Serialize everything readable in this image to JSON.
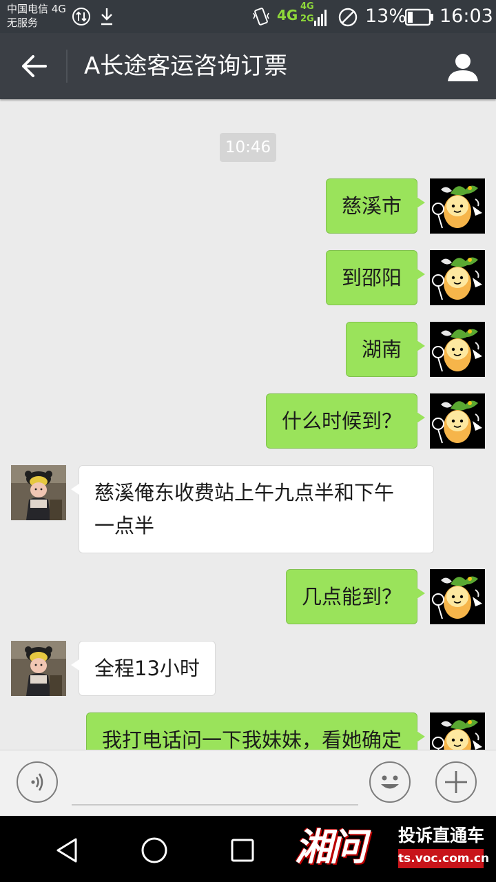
{
  "status_bar": {
    "carrier_line1": "中国电信 4G",
    "carrier_line2": "无服务",
    "network_4g": "4G",
    "network_sub_4g": "4G",
    "network_sub_2g": "2G",
    "battery": "13%",
    "time": "16:03"
  },
  "header": {
    "title": "A长途客运咨询订票"
  },
  "chat": {
    "timestamp": "10:46",
    "messages": [
      {
        "sender": "self",
        "text": "慈溪市"
      },
      {
        "sender": "self",
        "text": "到邵阳"
      },
      {
        "sender": "self",
        "text": "湖南"
      },
      {
        "sender": "self",
        "text": "什么时候到？"
      },
      {
        "sender": "other",
        "text": "慈溪俺东收费站上午九点半和下午\n一点半"
      },
      {
        "sender": "self",
        "text": "几点能到？"
      },
      {
        "sender": "other",
        "text": "全程13小时"
      },
      {
        "sender": "self",
        "text": "我打电话问一下我妹妹，看她确定"
      }
    ]
  },
  "input_bar": {
    "text_value": ""
  },
  "watermark": {
    "logo": "湘问",
    "subtitle": "投诉直通车",
    "url": "ts.voc.com.cn"
  },
  "colors": {
    "outgoing_bubble": "#9ae35b",
    "incoming_bubble": "#ffffff",
    "title_bar": "#3b3f45",
    "status_bar": "#353a40",
    "chat_background": "#ebebeb"
  }
}
